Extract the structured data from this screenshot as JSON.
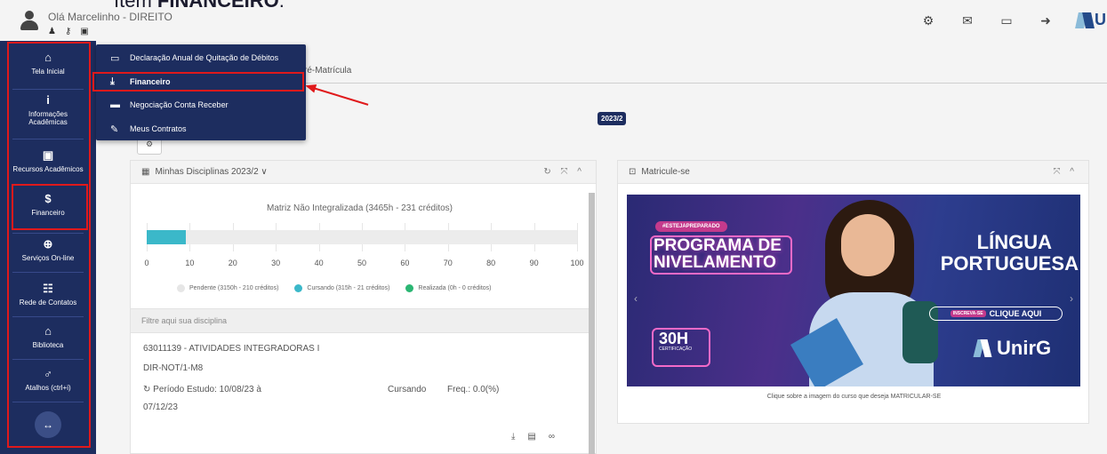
{
  "doc_heading": {
    "prefix": "Item ",
    "bold": "FINANCEIRO",
    "suffix": "."
  },
  "header": {
    "greeting": "Olá Marcelinho - DIREITO",
    "mini_icons": [
      "user-edit-icon",
      "key-icon",
      "camera-icon"
    ],
    "right_icons": [
      "cogs-icon",
      "envelope-icon",
      "laptop-icon",
      "sign-out-icon"
    ],
    "logo_text": "U"
  },
  "sidebar": {
    "items": [
      {
        "icon": "home-icon",
        "glyph": "⌂",
        "label": "Tela Inicial"
      },
      {
        "icon": "info-icon",
        "glyph": "i",
        "label": "Informações Acadêmicas"
      },
      {
        "icon": "calendar-icon",
        "glyph": "▣",
        "label": "Recursos Acadêmicos"
      },
      {
        "icon": "dollar-icon",
        "glyph": "$",
        "label": "Financeiro"
      },
      {
        "icon": "globe-icon",
        "glyph": "⊕",
        "label": "Serviços On-line"
      },
      {
        "icon": "users-icon",
        "glyph": "☷",
        "label": "Rede de Contatos"
      },
      {
        "icon": "library-icon",
        "glyph": "⌂",
        "label": "Biblioteca"
      },
      {
        "icon": "shortcut-icon",
        "glyph": "♂",
        "label": "Atalhos (ctrl+i)"
      }
    ],
    "toggle_glyph": "↔"
  },
  "dropdown": {
    "items": [
      {
        "icon": "id-card-icon",
        "glyph": "▭",
        "label": "Declaração Anual de Quitação de Débitos"
      },
      {
        "icon": "hand-money-icon",
        "glyph": "⤓",
        "label": "Financeiro"
      },
      {
        "icon": "credit-card-icon",
        "glyph": "▬",
        "label": "Negociação Conta Receber"
      },
      {
        "icon": "contract-icon",
        "glyph": "✎",
        "label": "Meus Contratos"
      }
    ]
  },
  "content": {
    "tab_label": "ré-Matrícula",
    "term_badge": "2023/2",
    "small_button_glyph": "⚙"
  },
  "disciplines_panel": {
    "title": "Minhas Disciplinas  2023/2 ∨",
    "header_tools": "↻ ⤧ ^",
    "chart_title": "Matriz Não Integralizada (3465h - 231 créditos)",
    "legend": [
      {
        "label": "Pendente (3150h - 210 créditos)",
        "color": "#e6e6e6"
      },
      {
        "label": "Cursando (315h - 21 créditos)",
        "color": "#3bb8c9"
      },
      {
        "label": "Realizada (0h - 0 créditos)",
        "color": "#2bb673"
      }
    ],
    "filter_placeholder": "Filtre aqui sua disciplina",
    "discipline": {
      "code_name": "63011139 - ATIVIDADES INTEGRADORAS I",
      "class": "DIR-NOT/1-M8",
      "period_line1": "↻ Período Estudo: 10/08/23 à",
      "period_line2": "07/12/23",
      "status": "Cursando",
      "frequency": "Freq.: 0.0(%)"
    }
  },
  "chart_data": {
    "type": "bar",
    "title": "Matriz Não Integralizada (3465h - 231 créditos)",
    "orientation": "horizontal",
    "xlim": [
      0,
      100
    ],
    "ticks": [
      0,
      10,
      20,
      30,
      40,
      50,
      60,
      70,
      80,
      90,
      100
    ],
    "series": [
      {
        "name": "Cursando (315h - 21 créditos)",
        "values": [
          9
        ]
      },
      {
        "name": "Realizada (0h - 0 créditos)",
        "values": [
          0
        ]
      },
      {
        "name": "Pendente (3150h - 210 créditos)",
        "values": [
          91
        ]
      }
    ],
    "colors": {
      "Pendente": "#e6e6e6",
      "Cursando": "#3bb8c9",
      "Realizada": "#2bb673"
    }
  },
  "enroll_panel": {
    "title": "Matricule-se",
    "header_tools": "⤧ ^",
    "banner": {
      "pill": "#ESTEJAPREPARADO",
      "headline": "PROGRAMA DE NIVELAMENTO",
      "hours": "30H",
      "hours_sub": "CERTIFICAÇÃO",
      "subject_line1": "LÍNGUA",
      "subject_line2": "PORTUGUESA",
      "cta_pre": "INSCREVA-SE",
      "cta": "CLIQUE AQUI",
      "brand": "UnirG"
    },
    "caption": "Clique sobre a imagem do curso que deseja MATRICULAR-SE"
  }
}
